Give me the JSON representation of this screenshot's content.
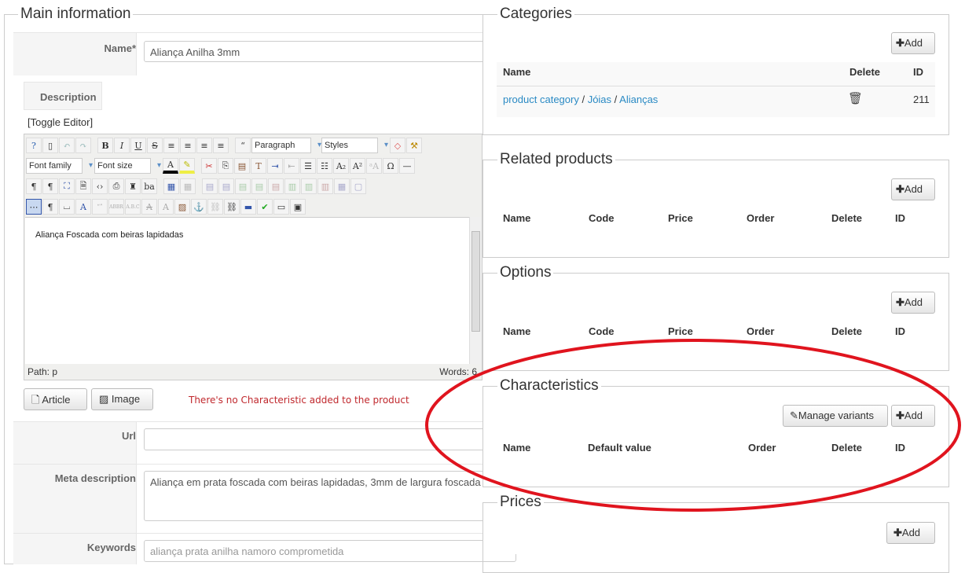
{
  "main": {
    "legend": "Main information",
    "name_label": "Name*",
    "name_value": "Aliança Anilha 3mm",
    "description_tab": "Description",
    "toggle_editor": "[Toggle Editor]",
    "editor": {
      "format_select": "Paragraph",
      "styles_select": "Styles",
      "font_family": "Font family",
      "font_size": "Font size",
      "content": "Aliança Foscada com beiras lapidadas",
      "path": "Path:  p",
      "words": "Words: 6"
    },
    "article_button": "Article",
    "image_button": "Image",
    "warning": "There's no Characteristic added to the product",
    "url_label": "Url",
    "url_value": "",
    "meta_label": "Meta description",
    "meta_value": "Aliança em prata foscada com beiras lapidadas, 3mm de largura foscada",
    "keywords_label": "Keywords",
    "keywords_value": "aliança prata anilha namoro comprometida"
  },
  "categories": {
    "legend": "Categories",
    "add": "Add",
    "cols": [
      "Name",
      "Delete",
      "ID"
    ],
    "rows": [
      {
        "path": [
          "product category",
          "Jóias",
          "Alianças"
        ],
        "sep": " / ",
        "id": "211"
      }
    ]
  },
  "related": {
    "legend": "Related products",
    "add": "Add",
    "cols": [
      "Name",
      "Code",
      "Price",
      "Order",
      "Delete",
      "ID"
    ]
  },
  "options": {
    "legend": "Options",
    "add": "Add",
    "cols": [
      "Name",
      "Code",
      "Price",
      "Order",
      "Delete",
      "ID"
    ]
  },
  "characteristics": {
    "legend": "Characteristics",
    "manage": "Manage variants",
    "add": "Add",
    "cols": [
      "Name",
      "Default value",
      "Order",
      "Delete",
      "ID"
    ]
  },
  "prices": {
    "legend": "Prices",
    "add": "Add"
  },
  "colors": {
    "annotation": "#e0141e",
    "link": "#2a8ac4",
    "warning": "#c0282d"
  }
}
